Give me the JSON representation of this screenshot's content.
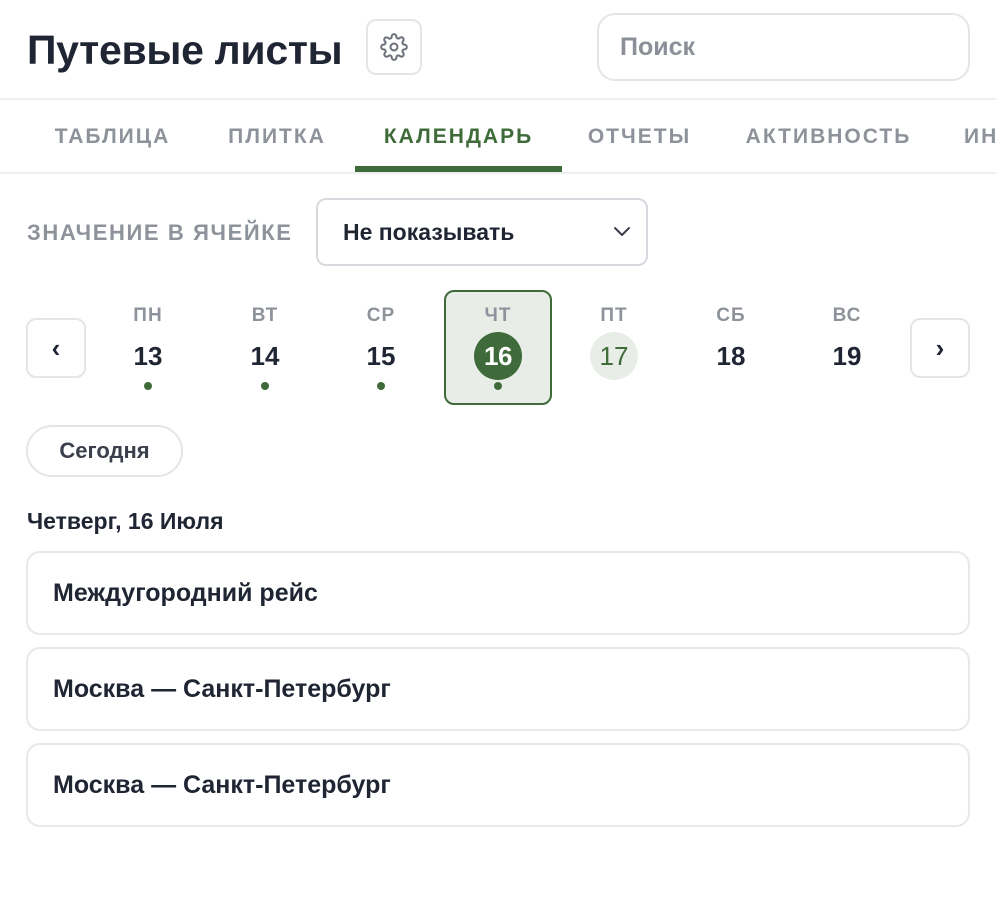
{
  "header": {
    "title": "Путевые листы",
    "settings_icon": "gear-icon",
    "search_placeholder": "Поиск"
  },
  "tabs": [
    {
      "label": "ТАБЛИЦА",
      "active": false
    },
    {
      "label": "ПЛИТКА",
      "active": false
    },
    {
      "label": "КАЛЕНДАРЬ",
      "active": true
    },
    {
      "label": "ОТЧЕТЫ",
      "active": false
    },
    {
      "label": "АКТИВНОСТЬ",
      "active": false
    },
    {
      "label": "ИН",
      "active": false
    }
  ],
  "cell_value": {
    "label": "ЗНАЧЕНИЕ В ЯЧЕЙКЕ",
    "selected": "Не показывать"
  },
  "week": {
    "prev_icon": "‹",
    "next_icon": "›",
    "days": [
      {
        "dow": "ПН",
        "num": "13",
        "has_events": true
      },
      {
        "dow": "ВТ",
        "num": "14",
        "has_events": true
      },
      {
        "dow": "СР",
        "num": "15",
        "has_events": true
      },
      {
        "dow": "ЧТ",
        "num": "16",
        "has_events": true,
        "selected": true
      },
      {
        "dow": "ПТ",
        "num": "17",
        "has_events": false,
        "today": true
      },
      {
        "dow": "СБ",
        "num": "18",
        "has_events": false
      },
      {
        "dow": "ВС",
        "num": "19",
        "has_events": false
      }
    ]
  },
  "today_button": "Сегодня",
  "date_heading": "Четверг, 16 Июля",
  "events": [
    {
      "title": "Междугородний рейс"
    },
    {
      "title": "Москва — Санкт-Петербург"
    },
    {
      "title": "Москва — Санкт-Петербург"
    }
  ],
  "colors": {
    "accent": "#3e6b39",
    "accent_light": "#e9ede8",
    "muted_text": "#8e929a",
    "text": "#1f2533"
  }
}
